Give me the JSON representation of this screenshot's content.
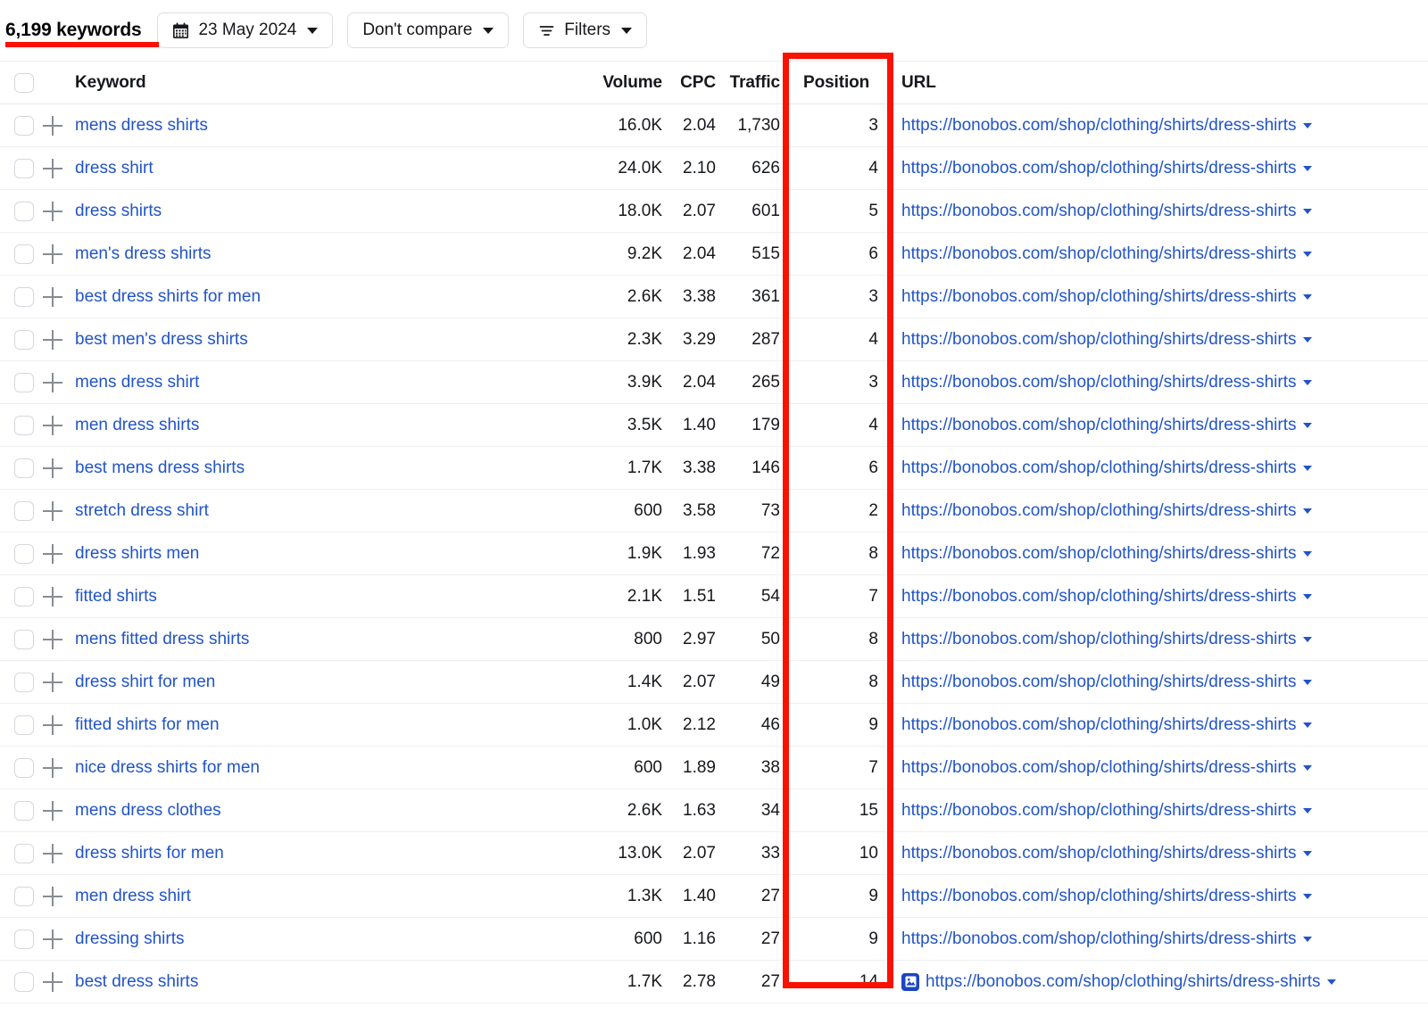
{
  "toolbar": {
    "keyword_count_label": "6,199 keywords",
    "date_button": {
      "label": "23 May 2024",
      "icon": "calendar-icon"
    },
    "compare_button": {
      "label": "Don't compare"
    },
    "filters_button": {
      "label": "Filters",
      "icon": "filter-icon"
    },
    "accent_color": "#fb1100"
  },
  "annotation": {
    "highlight_color": "#fb1100",
    "highlighted_column": "Position",
    "underlined_label": "6,199 keywords"
  },
  "table": {
    "columns": {
      "select_all": "",
      "keyword": "Keyword",
      "volume": "Volume",
      "cpc": "CPC",
      "traffic": "Traffic",
      "position": "Position",
      "url": "URL"
    },
    "link_color": "#2154c9",
    "rows": [
      {
        "keyword": "mens dress shirts",
        "volume": "16.0K",
        "cpc": "2.04",
        "traffic": "1,730",
        "position": "3",
        "url": "https://bonobos.com/shop/clothing/shirts/dress-shirts",
        "has_image_badge": false
      },
      {
        "keyword": "dress shirt",
        "volume": "24.0K",
        "cpc": "2.10",
        "traffic": "626",
        "position": "4",
        "url": "https://bonobos.com/shop/clothing/shirts/dress-shirts",
        "has_image_badge": false
      },
      {
        "keyword": "dress shirts",
        "volume": "18.0K",
        "cpc": "2.07",
        "traffic": "601",
        "position": "5",
        "url": "https://bonobos.com/shop/clothing/shirts/dress-shirts",
        "has_image_badge": false
      },
      {
        "keyword": "men's dress shirts",
        "volume": "9.2K",
        "cpc": "2.04",
        "traffic": "515",
        "position": "6",
        "url": "https://bonobos.com/shop/clothing/shirts/dress-shirts",
        "has_image_badge": false
      },
      {
        "keyword": "best dress shirts for men",
        "volume": "2.6K",
        "cpc": "3.38",
        "traffic": "361",
        "position": "3",
        "url": "https://bonobos.com/shop/clothing/shirts/dress-shirts",
        "has_image_badge": false
      },
      {
        "keyword": "best men's dress shirts",
        "volume": "2.3K",
        "cpc": "3.29",
        "traffic": "287",
        "position": "4",
        "url": "https://bonobos.com/shop/clothing/shirts/dress-shirts",
        "has_image_badge": false
      },
      {
        "keyword": "mens dress shirt",
        "volume": "3.9K",
        "cpc": "2.04",
        "traffic": "265",
        "position": "3",
        "url": "https://bonobos.com/shop/clothing/shirts/dress-shirts",
        "has_image_badge": false
      },
      {
        "keyword": "men dress shirts",
        "volume": "3.5K",
        "cpc": "1.40",
        "traffic": "179",
        "position": "4",
        "url": "https://bonobos.com/shop/clothing/shirts/dress-shirts",
        "has_image_badge": false
      },
      {
        "keyword": "best mens dress shirts",
        "volume": "1.7K",
        "cpc": "3.38",
        "traffic": "146",
        "position": "6",
        "url": "https://bonobos.com/shop/clothing/shirts/dress-shirts",
        "has_image_badge": false
      },
      {
        "keyword": "stretch dress shirt",
        "volume": "600",
        "cpc": "3.58",
        "traffic": "73",
        "position": "2",
        "url": "https://bonobos.com/shop/clothing/shirts/dress-shirts",
        "has_image_badge": false
      },
      {
        "keyword": "dress shirts men",
        "volume": "1.9K",
        "cpc": "1.93",
        "traffic": "72",
        "position": "8",
        "url": "https://bonobos.com/shop/clothing/shirts/dress-shirts",
        "has_image_badge": false
      },
      {
        "keyword": "fitted shirts",
        "volume": "2.1K",
        "cpc": "1.51",
        "traffic": "54",
        "position": "7",
        "url": "https://bonobos.com/shop/clothing/shirts/dress-shirts",
        "has_image_badge": false
      },
      {
        "keyword": "mens fitted dress shirts",
        "volume": "800",
        "cpc": "2.97",
        "traffic": "50",
        "position": "8",
        "url": "https://bonobos.com/shop/clothing/shirts/dress-shirts",
        "has_image_badge": false
      },
      {
        "keyword": "dress shirt for men",
        "volume": "1.4K",
        "cpc": "2.07",
        "traffic": "49",
        "position": "8",
        "url": "https://bonobos.com/shop/clothing/shirts/dress-shirts",
        "has_image_badge": false
      },
      {
        "keyword": "fitted shirts for men",
        "volume": "1.0K",
        "cpc": "2.12",
        "traffic": "46",
        "position": "9",
        "url": "https://bonobos.com/shop/clothing/shirts/dress-shirts",
        "has_image_badge": false
      },
      {
        "keyword": "nice dress shirts for men",
        "volume": "600",
        "cpc": "1.89",
        "traffic": "38",
        "position": "7",
        "url": "https://bonobos.com/shop/clothing/shirts/dress-shirts",
        "has_image_badge": false
      },
      {
        "keyword": "mens dress clothes",
        "volume": "2.6K",
        "cpc": "1.63",
        "traffic": "34",
        "position": "15",
        "url": "https://bonobos.com/shop/clothing/shirts/dress-shirts",
        "has_image_badge": false
      },
      {
        "keyword": "dress shirts for men",
        "volume": "13.0K",
        "cpc": "2.07",
        "traffic": "33",
        "position": "10",
        "url": "https://bonobos.com/shop/clothing/shirts/dress-shirts",
        "has_image_badge": false
      },
      {
        "keyword": "men dress shirt",
        "volume": "1.3K",
        "cpc": "1.40",
        "traffic": "27",
        "position": "9",
        "url": "https://bonobos.com/shop/clothing/shirts/dress-shirts",
        "has_image_badge": false
      },
      {
        "keyword": "dressing shirts",
        "volume": "600",
        "cpc": "1.16",
        "traffic": "27",
        "position": "9",
        "url": "https://bonobos.com/shop/clothing/shirts/dress-shirts",
        "has_image_badge": false
      },
      {
        "keyword": "best dress shirts",
        "volume": "1.7K",
        "cpc": "2.78",
        "traffic": "27",
        "position": "14",
        "url": "https://bonobos.com/shop/clothing/shirts/dress-shirts",
        "has_image_badge": true
      }
    ]
  }
}
